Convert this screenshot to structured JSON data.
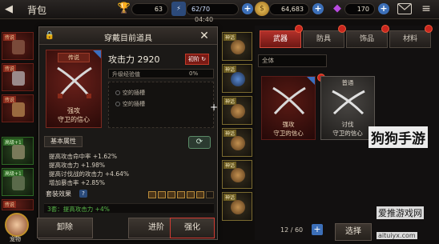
{
  "header": {
    "title": "背包",
    "trophy_count": "63",
    "energy": "62/70",
    "timer": "04:40",
    "gold": "64,683",
    "gems": "170"
  },
  "left_slots": [
    {
      "tag": "传说",
      "style": "red"
    },
    {
      "tag": "传说",
      "style": "red"
    },
    {
      "tag": "传说",
      "style": "red"
    },
    {
      "tag": "高级+1",
      "style": "green"
    },
    {
      "tag": "高级+1",
      "style": "green"
    },
    {
      "tag": "传说",
      "style": "red"
    }
  ],
  "pet": {
    "label": "宠物"
  },
  "dialog": {
    "title": "穿戴目前道具",
    "item_rarity": "传说",
    "item_caption_1": "强攻",
    "item_caption_2": "守卫的信心",
    "attack_label": "攻击力 2920",
    "first_badge": "初阶",
    "xp_label": "升级经验值",
    "xp_value": "0%",
    "xp_progress": 0,
    "sockets": [
      "空的插槽",
      "空的插槽"
    ],
    "attr_tab": "基本属性",
    "attributes": [
      "提高攻击命中率 +1.62%",
      "提高攻击力 +1.98%",
      "提高讨伐战的攻击力 +4.64%",
      "增加暴击率 +2.85%"
    ],
    "set_label": "套装效果",
    "help": "?",
    "set_bonus": "3套：提高攻击力 +4%",
    "buttons": {
      "remove": "卸除",
      "advance": "进阶",
      "enhance": "强化"
    }
  },
  "middle_slots": [
    {
      "tag": "神话"
    },
    {
      "tag": "神话"
    },
    {
      "tag": "神话"
    },
    {
      "tag": "神话"
    },
    {
      "tag": "神话"
    },
    {
      "tag": "神话"
    }
  ],
  "tabs": [
    "武器",
    "防具",
    "饰品",
    "材料"
  ],
  "filter": "全体",
  "cards": [
    {
      "rarity": "",
      "caption_1": "强攻",
      "caption_2": "守卫的信心"
    },
    {
      "rarity": "普通",
      "caption_1": "讨伐",
      "caption_2": "守卫的信心"
    }
  ],
  "footer": {
    "count": "12 / 60",
    "select": "选择"
  },
  "watermark": {
    "site": "爱推游戏网",
    "logo": "狗狗手游",
    "domain": "aituiyx.com"
  },
  "colors": {
    "accent_red": "#c8261e",
    "gold": "#e6b840",
    "positive_green": "#58b84a"
  }
}
